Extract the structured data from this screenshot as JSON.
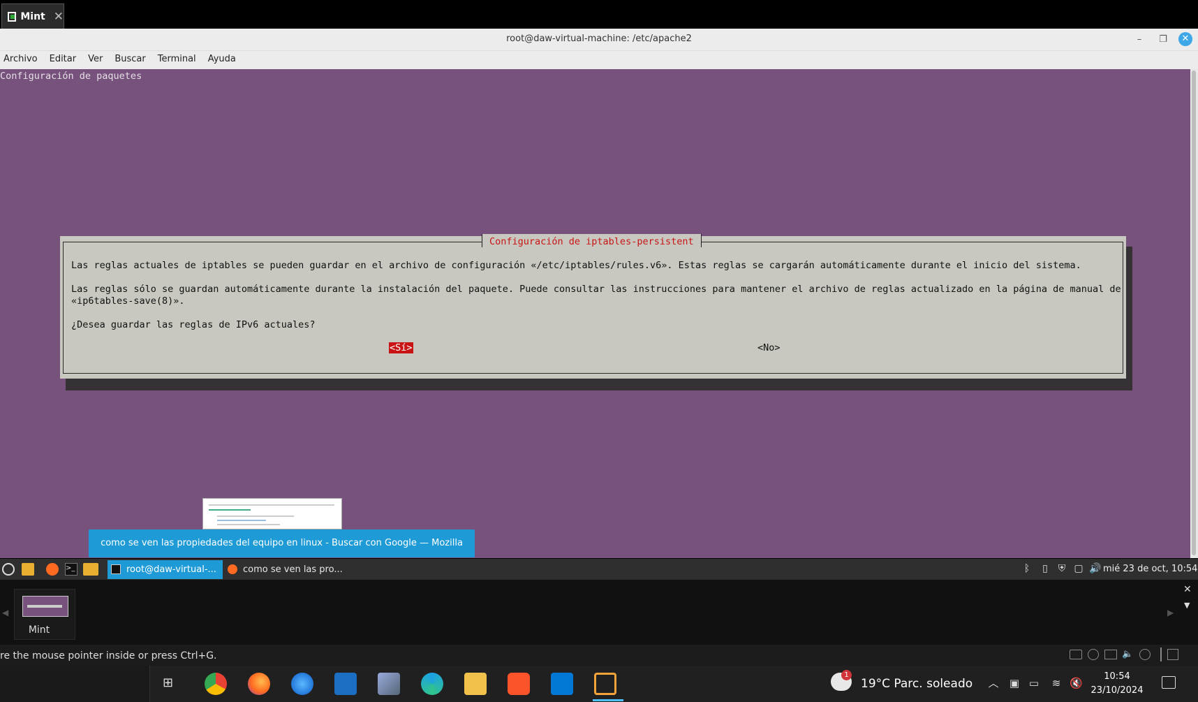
{
  "vm_tab": {
    "label": "Mint"
  },
  "window": {
    "title": "root@daw-virtual-machine: /etc/apache2"
  },
  "menu": [
    "Archivo",
    "Editar",
    "Ver",
    "Buscar",
    "Terminal",
    "Ayuda"
  ],
  "terminal": {
    "header": "Configuración de paquetes",
    "dialog": {
      "title": "Configuración de iptables-persistent",
      "line1": "Las reglas actuales de iptables se pueden guardar en el archivo de configuración «/etc/iptables/rules.v6». Estas reglas se cargarán automáticamente durante el inicio del sistema.",
      "line2": "Las reglas sólo se guardan automáticamente durante la instalación del paquete. Puede consultar las instrucciones para mantener el archivo de reglas actualizado en la página de manual de",
      "line3": "«ip6tables-save(8)».",
      "question": "¿Desea guardar las reglas de IPv6 actuales?",
      "yes": "<Sí>",
      "no": "<No>"
    }
  },
  "tooltip": "como se ven las propiedades del equipo en linux - Buscar con Google — Mozilla Firefox",
  "mint_panel": {
    "tasks": [
      {
        "label": "root@daw-virtual-..."
      },
      {
        "label": "como se ven las pro..."
      }
    ],
    "clock": "mié 23 de oct, 10:54"
  },
  "vmware": {
    "thumb_label": "Mint",
    "status_message": "re the mouse pointer inside or press Ctrl+G."
  },
  "windows_taskbar": {
    "weather": "19°C  Parc. soleado",
    "weather_badge": "1",
    "time": "10:54",
    "date": "23/10/2024"
  },
  "colors": {
    "terminal_bg": "#76527c",
    "dialog_bg": "#c8c8c1",
    "dialog_title": "#c81414",
    "accent_blue": "#1e9bd7"
  }
}
